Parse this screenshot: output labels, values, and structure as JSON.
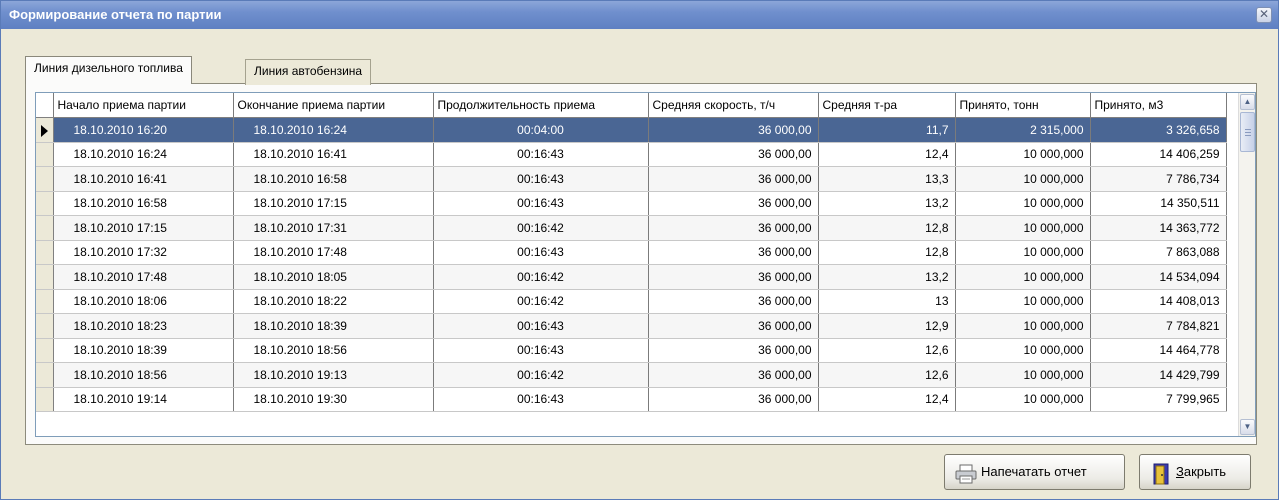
{
  "window": {
    "title": "Формирование отчета по партии",
    "close_glyph": "✕"
  },
  "tabs": [
    {
      "label": "Линия дизельного топлива",
      "active": true
    },
    {
      "label": "Линия автобензина",
      "active": false
    }
  ],
  "grid": {
    "columns": [
      "Начало приема партии",
      "Окончание приема партии",
      "Продолжительность приема",
      "Средняя скорость, т/ч",
      "Средняя т-ра",
      "Принято, тонн",
      "Принято, м3"
    ],
    "rows": [
      [
        "18.10.2010 16:20",
        "18.10.2010 16:24",
        "00:04:00",
        "36 000,00",
        "11,7",
        "2 315,000",
        "3 326,658"
      ],
      [
        "18.10.2010 16:24",
        "18.10.2010 16:41",
        "00:16:43",
        "36 000,00",
        "12,4",
        "10 000,000",
        "14 406,259"
      ],
      [
        "18.10.2010 16:41",
        "18.10.2010 16:58",
        "00:16:43",
        "36 000,00",
        "13,3",
        "10 000,000",
        "7 786,734"
      ],
      [
        "18.10.2010 16:58",
        "18.10.2010 17:15",
        "00:16:43",
        "36 000,00",
        "13,2",
        "10 000,000",
        "14 350,511"
      ],
      [
        "18.10.2010 17:15",
        "18.10.2010 17:31",
        "00:16:42",
        "36 000,00",
        "12,8",
        "10 000,000",
        "14 363,772"
      ],
      [
        "18.10.2010 17:32",
        "18.10.2010 17:48",
        "00:16:43",
        "36 000,00",
        "12,8",
        "10 000,000",
        "7 863,088"
      ],
      [
        "18.10.2010 17:48",
        "18.10.2010 18:05",
        "00:16:42",
        "36 000,00",
        "13,2",
        "10 000,000",
        "14 534,094"
      ],
      [
        "18.10.2010 18:06",
        "18.10.2010 18:22",
        "00:16:42",
        "36 000,00",
        "13",
        "10 000,000",
        "14 408,013"
      ],
      [
        "18.10.2010 18:23",
        "18.10.2010 18:39",
        "00:16:43",
        "36 000,00",
        "12,9",
        "10 000,000",
        "7 784,821"
      ],
      [
        "18.10.2010 18:39",
        "18.10.2010 18:56",
        "00:16:43",
        "36 000,00",
        "12,6",
        "10 000,000",
        "14 464,778"
      ],
      [
        "18.10.2010 18:56",
        "18.10.2010 19:13",
        "00:16:42",
        "36 000,00",
        "12,6",
        "10 000,000",
        "14 429,799"
      ],
      [
        "18.10.2010 19:14",
        "18.10.2010 19:30",
        "00:16:43",
        "36 000,00",
        "12,4",
        "10 000,000",
        "7 799,965"
      ]
    ],
    "selected_row": 0
  },
  "buttons": {
    "print_label": "Напечатать отчет",
    "close_label_mnemonic": "З",
    "close_label_rest": "акрыть"
  },
  "icons": {
    "print": "printer-icon",
    "close": "door-exit-icon",
    "scroll_up": "▲",
    "scroll_down": "▼"
  },
  "colors": {
    "titlebar": "#6f8fcd",
    "selection": "#4a6694",
    "window_bg": "#ece9d8"
  }
}
